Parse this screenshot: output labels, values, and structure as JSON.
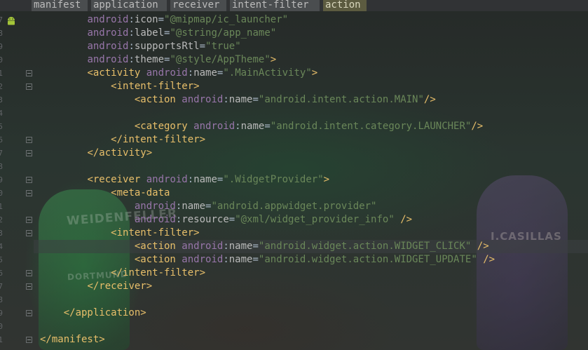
{
  "breadcrumb": [
    {
      "label": "manifest",
      "active": false
    },
    {
      "label": "application",
      "active": false
    },
    {
      "label": "receiver",
      "active": false
    },
    {
      "label": "intent-filter",
      "active": false
    },
    {
      "label": "action",
      "active": true
    }
  ],
  "background_overlay": {
    "left_player_name": "WEIDENFELLER",
    "left_player_sponsor": "DORTMUND",
    "right_player_name": "I.CASILLAS"
  },
  "colors": {
    "tag": "#e8bf6a",
    "namespace": "#9876aa",
    "attribute": "#bababa",
    "value": "#6a8759",
    "plain": "#a9b7c6",
    "breadcrumb_active": "#5c5b40"
  },
  "code": {
    "first_line_number": 1,
    "lines": [
      [
        [
          "",
          "        "
        ],
        [
          "ns",
          "android"
        ],
        [
          "plain",
          ":"
        ],
        [
          "attr",
          "icon"
        ],
        [
          "plain",
          "="
        ],
        [
          "val",
          "\"@mipmap/ic_launcher\""
        ]
      ],
      [
        [
          "",
          "        "
        ],
        [
          "ns",
          "android"
        ],
        [
          "plain",
          ":"
        ],
        [
          "attr",
          "label"
        ],
        [
          "plain",
          "="
        ],
        [
          "val",
          "\"@string/app_name\""
        ]
      ],
      [
        [
          "",
          "        "
        ],
        [
          "ns",
          "android"
        ],
        [
          "plain",
          ":"
        ],
        [
          "attr",
          "supportsRtl"
        ],
        [
          "plain",
          "="
        ],
        [
          "val",
          "\"true\""
        ]
      ],
      [
        [
          "",
          "        "
        ],
        [
          "ns",
          "android"
        ],
        [
          "plain",
          ":"
        ],
        [
          "attr",
          "theme"
        ],
        [
          "plain",
          "="
        ],
        [
          "val",
          "\"@style/AppTheme\""
        ],
        [
          "tag",
          ">"
        ]
      ],
      [
        [
          "",
          "        "
        ],
        [
          "tag",
          "<activity "
        ],
        [
          "ns",
          "android"
        ],
        [
          "plain",
          ":"
        ],
        [
          "attr",
          "name"
        ],
        [
          "plain",
          "="
        ],
        [
          "val",
          "\".MainActivity\""
        ],
        [
          "tag",
          ">"
        ]
      ],
      [
        [
          "",
          "            "
        ],
        [
          "tag",
          "<intent-filter>"
        ]
      ],
      [
        [
          "",
          "                "
        ],
        [
          "tag",
          "<action "
        ],
        [
          "ns",
          "android"
        ],
        [
          "plain",
          ":"
        ],
        [
          "attr",
          "name"
        ],
        [
          "plain",
          "="
        ],
        [
          "val",
          "\"android.intent.action.MAIN\""
        ],
        [
          "tag",
          "/>"
        ]
      ],
      [],
      [
        [
          "",
          "                "
        ],
        [
          "tag",
          "<category "
        ],
        [
          "ns",
          "android"
        ],
        [
          "plain",
          ":"
        ],
        [
          "attr",
          "name"
        ],
        [
          "plain",
          "="
        ],
        [
          "val",
          "\"android.intent.category.LAUNCHER\""
        ],
        [
          "tag",
          "/>"
        ]
      ],
      [
        [
          "",
          "            "
        ],
        [
          "tag",
          "</intent-filter>"
        ]
      ],
      [
        [
          "",
          "        "
        ],
        [
          "tag",
          "</activity>"
        ]
      ],
      [],
      [
        [
          "",
          "        "
        ],
        [
          "tag",
          "<receiver "
        ],
        [
          "ns",
          "android"
        ],
        [
          "plain",
          ":"
        ],
        [
          "attr",
          "name"
        ],
        [
          "plain",
          "="
        ],
        [
          "val",
          "\".WidgetProvider\""
        ],
        [
          "tag",
          ">"
        ]
      ],
      [
        [
          "",
          "            "
        ],
        [
          "tag",
          "<meta-data"
        ]
      ],
      [
        [
          "",
          "                "
        ],
        [
          "ns",
          "android"
        ],
        [
          "plain",
          ":"
        ],
        [
          "attr",
          "name"
        ],
        [
          "plain",
          "="
        ],
        [
          "val",
          "\"android.appwidget.provider\""
        ]
      ],
      [
        [
          "",
          "                "
        ],
        [
          "ns",
          "android"
        ],
        [
          "plain",
          ":"
        ],
        [
          "attr",
          "resource"
        ],
        [
          "plain",
          "="
        ],
        [
          "val",
          "\"@xml/widget_provider_info\""
        ],
        [
          "plain",
          " "
        ],
        [
          "tag",
          "/>"
        ]
      ],
      [
        [
          "",
          "            "
        ],
        [
          "tag",
          "<intent-filter>"
        ]
      ],
      [
        [
          "",
          "                "
        ],
        [
          "tag",
          "<action "
        ],
        [
          "ns",
          "android"
        ],
        [
          "plain",
          ":"
        ],
        [
          "attr",
          "name"
        ],
        [
          "plain",
          "="
        ],
        [
          "val",
          "\"android.widget.action.WIDGET_CLICK\""
        ],
        [
          "plain",
          " "
        ],
        [
          "tag",
          "/>"
        ]
      ],
      [
        [
          "",
          "                "
        ],
        [
          "tag",
          "<action "
        ],
        [
          "ns",
          "android"
        ],
        [
          "plain",
          ":"
        ],
        [
          "attr",
          "name"
        ],
        [
          "plain",
          "="
        ],
        [
          "val",
          "\"android.widget.action.WIDGET_UPDATE\""
        ],
        [
          "plain",
          " "
        ],
        [
          "tag",
          "/>"
        ]
      ],
      [
        [
          "",
          "            "
        ],
        [
          "tag",
          "</intent-filter>"
        ]
      ],
      [
        [
          "",
          "        "
        ],
        [
          "tag",
          "</receiver>"
        ]
      ],
      [],
      [
        [
          "",
          "    "
        ],
        [
          "tag",
          "</application>"
        ]
      ],
      [],
      [
        [
          "",
          ""
        ],
        [
          "tag",
          "</manifest>"
        ]
      ]
    ],
    "line_numbers": [
      "7",
      "8",
      "9",
      "0",
      "1",
      "2",
      "3",
      "4",
      "5",
      "6",
      "7",
      "8",
      "9",
      "0",
      "1",
      "2",
      "3",
      "4",
      "5",
      "6",
      "7",
      "8",
      "9",
      "0",
      "1"
    ],
    "current_line_index": 17,
    "fold_marker_lines": [
      4,
      5,
      9,
      10,
      12,
      13,
      15,
      16,
      19,
      20,
      22,
      24
    ]
  }
}
